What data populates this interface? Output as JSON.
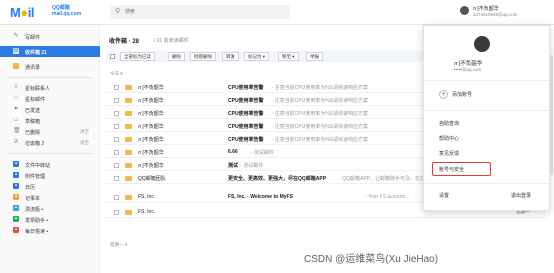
{
  "header": {
    "logo_text": "Mail",
    "logo_sub": "QQ邮箱\nmail.qq.com",
    "search_placeholder": "搜索",
    "user_name": "л ]不负韶华",
    "user_email": "1374915945@qq.com"
  },
  "sidebar": {
    "compose": "写邮件",
    "inbox": "收件箱 21",
    "contacts": "通讯录",
    "items": [
      {
        "label": "星标联系人",
        "tail": ""
      },
      {
        "label": "星标邮件",
        "tail": ""
      },
      {
        "label": "已发送",
        "tail": ""
      },
      {
        "label": "草稿箱",
        "tail": ""
      },
      {
        "label": "已删除",
        "tail": "清空"
      },
      {
        "label": "垃圾箱 2",
        "tail": "清空"
      }
    ],
    "apps": [
      {
        "label": "文件中转站"
      },
      {
        "label": "附件管理"
      },
      {
        "label": "日历"
      },
      {
        "label": "记事本"
      },
      {
        "label": "漂流瓶 •"
      },
      {
        "label": "发票助手 •"
      },
      {
        "label": "每日悦读 •"
      }
    ]
  },
  "main": {
    "folder_title": "收件箱 · 28",
    "folder_sub": "/ 21 封未读邮件",
    "toolbar": [
      "全部标为已读",
      "删除",
      "彻底删除",
      "转发",
      "标记为 ▾",
      "移至 ▾",
      "举报"
    ],
    "group_today": "今天 8",
    "group_week": "星期一 4",
    "rows": [
      {
        "sender": "л ]不负韶华",
        "subject": "CPU使用率告警",
        "preview": "- 注意当前CPU使用率为%S请快速响应方案",
        "date": "今天"
      },
      {
        "sender": "л ]不负韶华",
        "subject": "CPU使用率告警",
        "preview": "- 注意当前CPU使用率为%S请快速响应方案",
        "date": "今天"
      },
      {
        "sender": "л ]不负韶华",
        "subject": "CPU使用率告警",
        "preview": "- 注意当前CPU使用率为%S请快速响应方案",
        "date": "今天"
      },
      {
        "sender": "л ]不负韶华",
        "subject": "CPU使用率告警",
        "preview": "- 注意当前CPU使用率为%S请快速响应方案",
        "date": "今天"
      },
      {
        "sender": "л ]不负韶华",
        "subject": "CPU使用率告警",
        "preview": "- 注意当前CPU使用率为%S请快速响应方案",
        "date": "今天"
      },
      {
        "sender": "л ]不负韶华",
        "subject": "6.66",
        "preview": "- 测试邮件",
        "date": "今天"
      },
      {
        "sender": "л ]不负韶华",
        "subject": "测试",
        "preview": "- 测试邮件",
        "date": "今天 11:54"
      },
      {
        "sender": "QQ邮箱团队",
        "subject": "更安全、更高效、更强大，尽在QQ邮箱APP",
        "preview": "- QQ邮箱APP，让邮箱随手可及、在这里，你可以随便看看...",
        "date": "今天 10:30"
      },
      {
        "sender": "FS, Inc.",
        "subject": "FS, Inc. - Welcome to MyFS",
        "preview": "- Your FS account...",
        "date": "星期一"
      },
      {
        "sender": "FS, Inc.",
        "subject": "",
        "preview": "",
        "date": "星期一"
      }
    ]
  },
  "dropdown": {
    "name": "л ]不负韶华",
    "email": "•••••@qq.com",
    "add_account": "添加账号",
    "items": [
      "自助查询",
      "帮助中心",
      "意见反馈",
      "账号与安全"
    ],
    "settings": "设置",
    "logout": "退出登录"
  },
  "watermark": "CSDN @运维菜鸟(Xu JieHao)",
  "colors": {
    "accent": "#2c7be5",
    "highlight": "#e53935",
    "envelope": "#f2b84b"
  }
}
